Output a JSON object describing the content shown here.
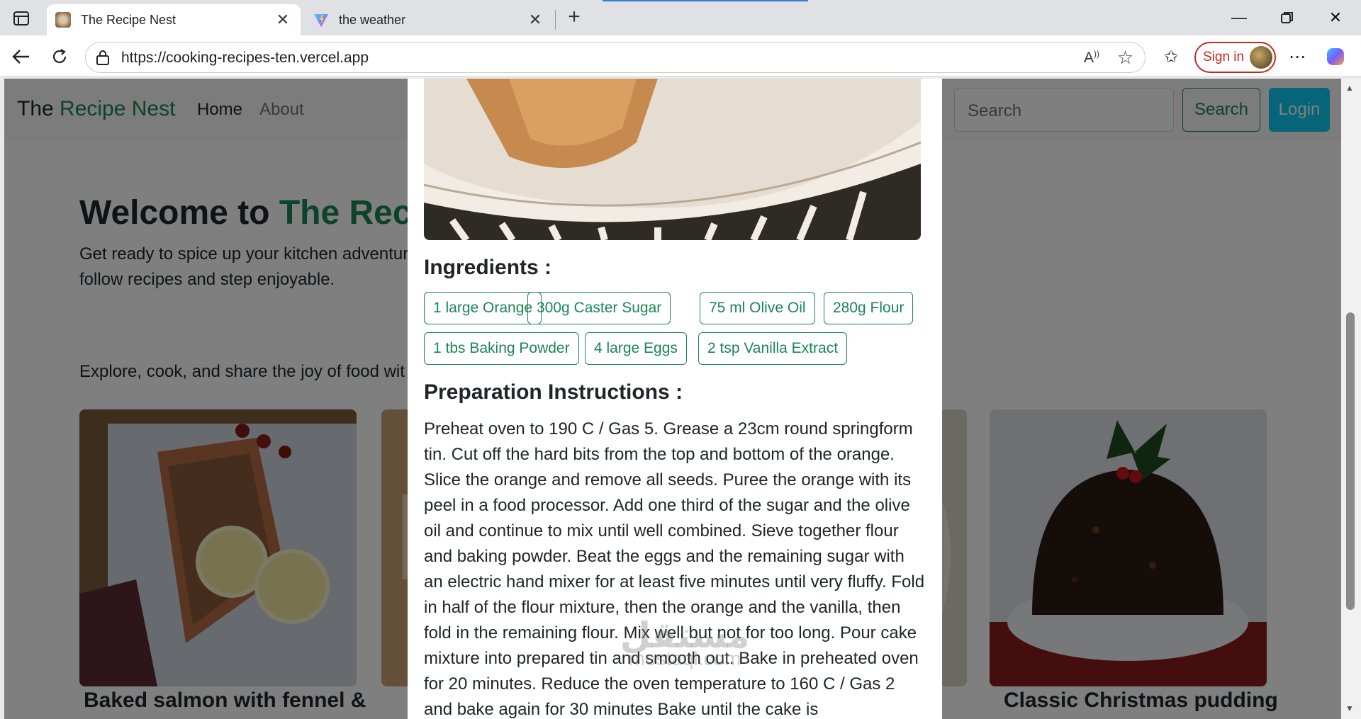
{
  "browser": {
    "tabs": [
      {
        "title": "The Recipe Nest",
        "active": true
      },
      {
        "title": "the weather",
        "active": false
      }
    ],
    "url": "https://cooking-recipes-ten.vercel.app",
    "signin_label": "Sign in"
  },
  "navbar": {
    "brand_prefix": "The",
    "brand_accent": "Recipe Nest",
    "links": [
      "Home",
      "About"
    ],
    "search_placeholder": "Search",
    "search_button": "Search",
    "login_button": "Login"
  },
  "hero": {
    "title_prefix": "Welcome to",
    "title_accent": "The Recip",
    "paragraph": "Get ready to spice up your kitchen adventur cooking tips, and culinary inspiration from a starting, our easy-to-follow recipes and step enjoyable.",
    "paragraph2": "Explore, cook, and share the joy of food wit"
  },
  "cards": [
    {
      "title": "Baked salmon with fennel &"
    },
    {
      "title": "Classic Christmas pudding"
    }
  ],
  "modal": {
    "ingredients_heading": "Ingredients :",
    "ingredients": [
      "1 large Orange",
      "300g Caster Sugar",
      "75 ml Olive Oil",
      "280g Flour",
      "1 tbs Baking Powder",
      "4 large Eggs",
      "2 tsp Vanilla Extract"
    ],
    "instructions_heading": "Preparation Instructions :",
    "instructions": "Preheat oven to 190 C / Gas 5. Grease a 23cm round springform tin. Cut off the hard bits from the top and bottom of the orange. Slice the orange and remove all seeds. Puree the orange with its peel in a food processor. Add one third of the sugar and the olive oil and continue to mix until well combined. Sieve together flour and baking powder. Beat the eggs and the remaining sugar with an electric hand mixer for at least five minutes until very fluffy. Fold in half of the flour mixture, then the orange and the vanilla, then fold in the remaining flour. Mix well but not for too long. Pour cake mixture into prepared tin and smooth out. Bake in preheated oven for 20 minutes. Reduce the oven temperature to 160 C / Gas 2 and bake again for 30 minutes Bake until the cake is"
  },
  "watermark": {
    "arabic": "مستقل",
    "latin": "mostaql.com"
  },
  "colors": {
    "accent": "#198754",
    "login": "#0dcaf0",
    "signin": "#c42b1c"
  }
}
